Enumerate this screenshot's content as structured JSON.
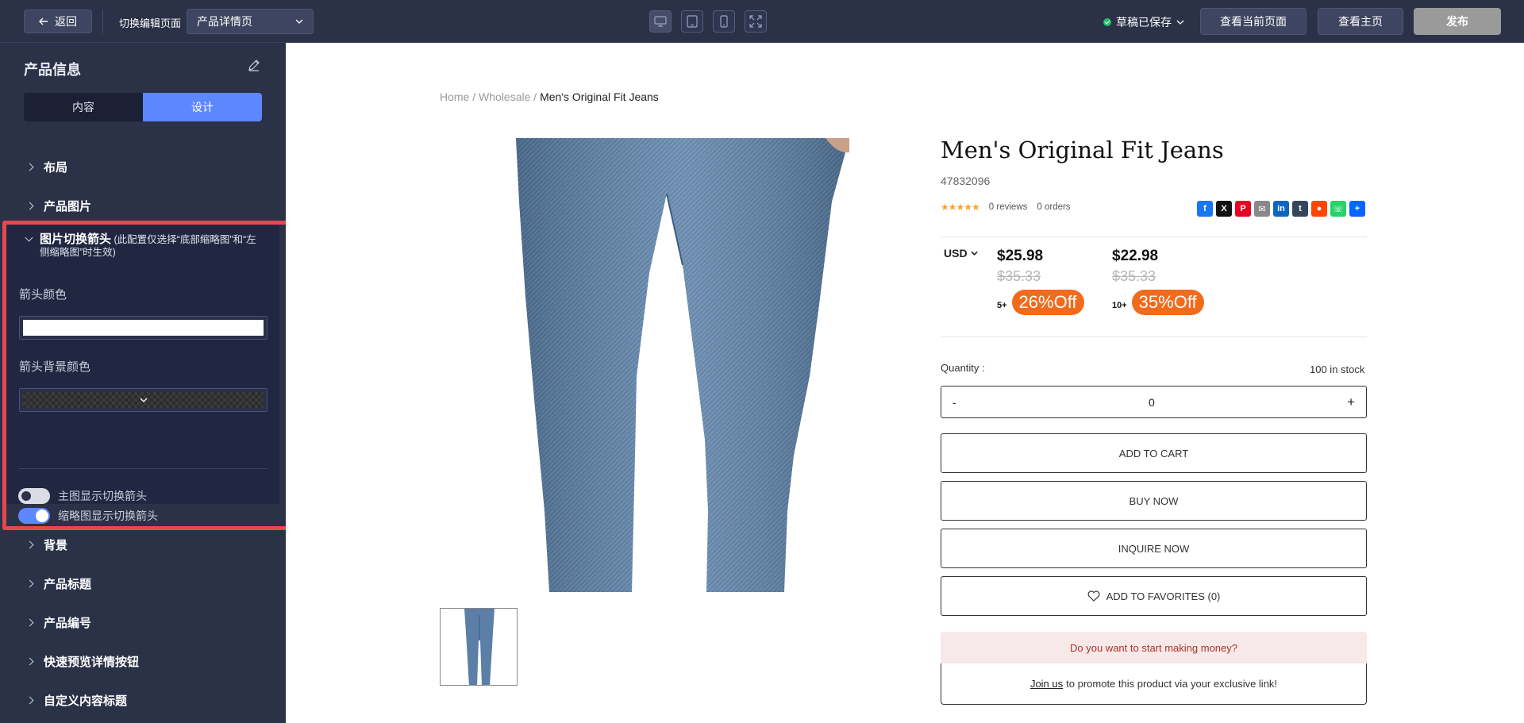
{
  "topbar": {
    "back_label": "返回",
    "switch_label": "切换编辑页面",
    "page_select": "产品详情页",
    "saved_label": "草稿已保存",
    "view_current": "查看当前页面",
    "view_home": "查看主页",
    "publish": "发布"
  },
  "sidebar": {
    "title": "产品信息",
    "tabs": {
      "content": "内容",
      "design": "设计"
    },
    "sections": {
      "layout": "布局",
      "images": "产品图片",
      "background": "背景",
      "product_title": "产品标题",
      "product_number": "产品编号",
      "quick_preview": "快速预览详情按钮",
      "custom_title": "自定义内容标题"
    },
    "expanded": {
      "title": "图片切换箭头",
      "note": "(此配置仅选择“底部缩略图”和“左侧缩略图”时生效)",
      "arrow_color_label": "箭头颜色",
      "arrow_bg_label": "箭头背景颜色",
      "toggle_main_label": "主图显示切换箭头",
      "toggle_main_on": false,
      "toggle_thumb_label": "缩略图显示切换箭头",
      "toggle_thumb_on": true
    }
  },
  "product": {
    "breadcrumb": {
      "home": "Home",
      "sep": "/",
      "wholesale": "Wholesale",
      "current": "Men's Original Fit Jeans"
    },
    "title": "Men's Original Fit Jeans",
    "sku": "47832096",
    "stars": "★★★★★",
    "reviews": "0 reviews",
    "orders": "0 orders",
    "currency": "USD",
    "tiers": [
      {
        "price": "$25.98",
        "old": "$35.33",
        "min": "5+",
        "off": "26%Off"
      },
      {
        "price": "$22.98",
        "old": "$35.33",
        "min": "10+",
        "off": "35%Off"
      }
    ],
    "quantity_label": "Quantity :",
    "stock": "100 in stock",
    "qty_minus": "-",
    "qty_value": "0",
    "qty_plus": "+",
    "add_to_cart": "ADD TO CART",
    "buy_now": "BUY NOW",
    "inquire_now": "INQUIRE NOW",
    "add_to_favorites": "ADD TO FAVORITES (0)",
    "money_question": "Do you want to start making money?",
    "join_us": "Join us",
    "promote_text": "to promote this product via your exclusive link!"
  },
  "colors": {
    "accent": "#5d87ff",
    "highlight": "#e5484d",
    "discount": "#f26a1b",
    "saved_ok": "#21c065"
  }
}
